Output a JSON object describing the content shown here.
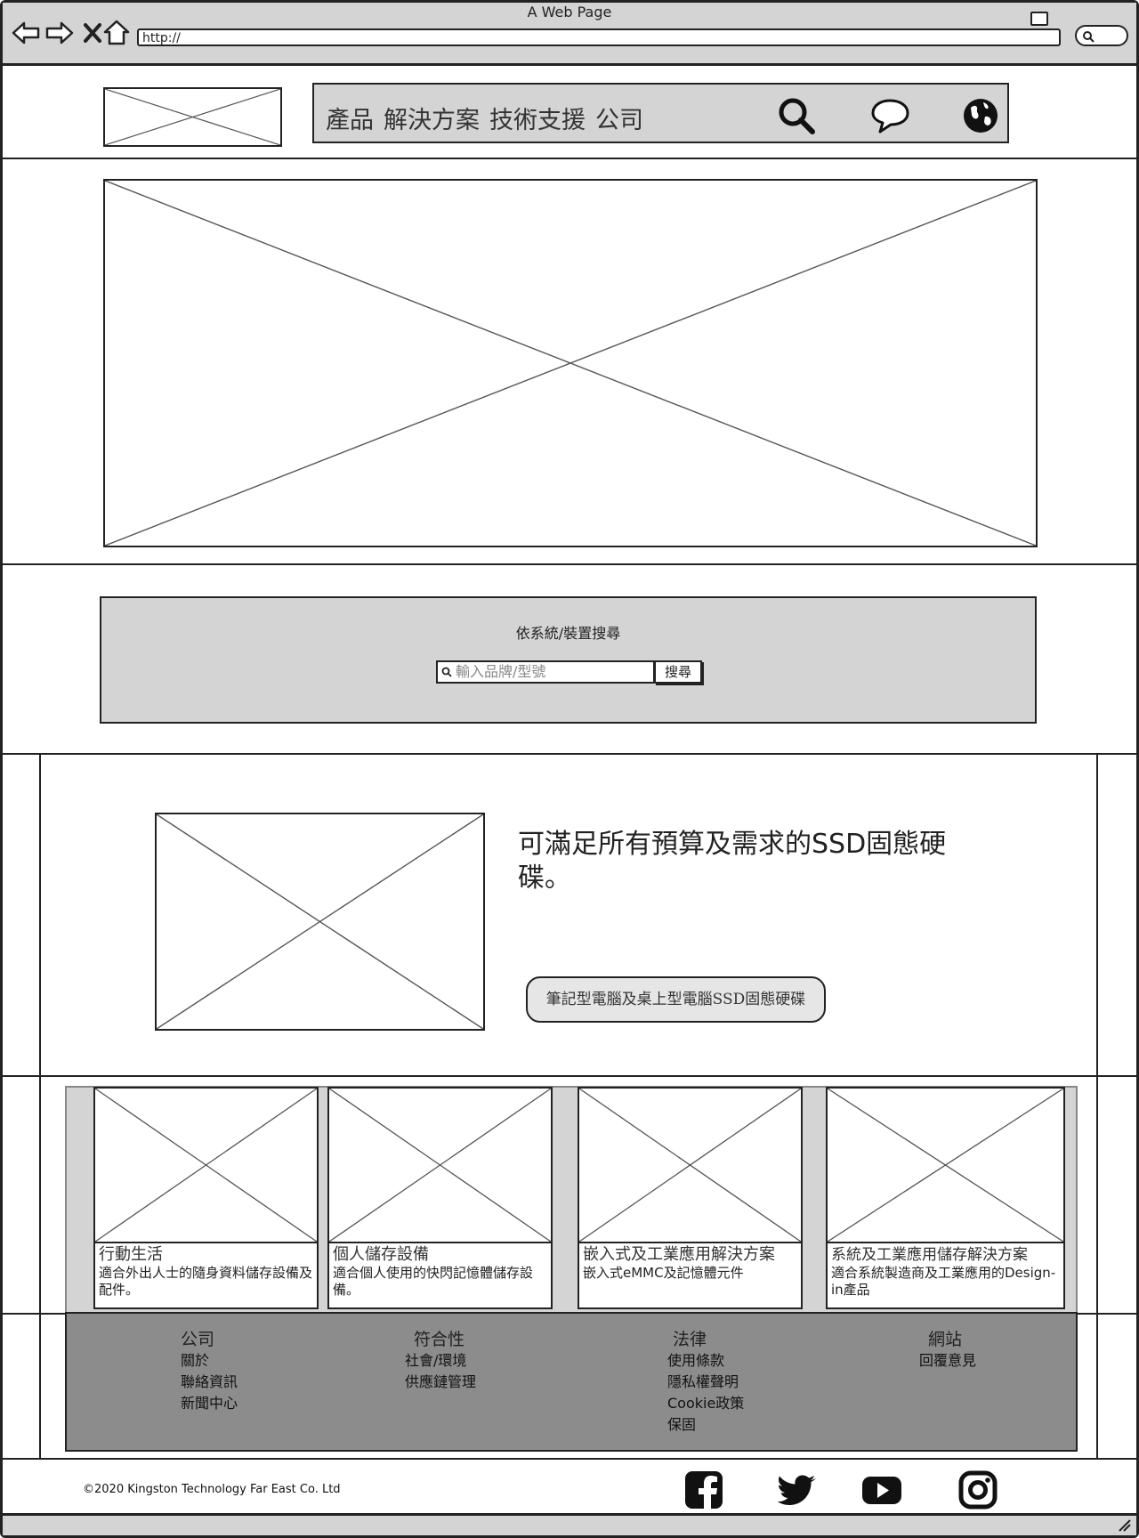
{
  "window": {
    "title": "A Web Page",
    "url": "http://"
  },
  "nav": {
    "items": [
      "產品",
      "解決方案",
      "技術支援",
      "公司"
    ]
  },
  "device_search": {
    "label": "依系統/裝置搜尋",
    "placeholder": "輸入品牌/型號",
    "button": "搜尋"
  },
  "promo": {
    "headline": "可滿足所有預算及需求的SSD固態硬碟。",
    "button": "筆記型電腦及桌上型電腦SSD固態硬碟"
  },
  "cards": [
    {
      "title": "行動生活",
      "desc": "適合外出人士的隨身資料儲存設備及配件。"
    },
    {
      "title": "個人儲存設備",
      "desc": "適合個人使用的快閃記憶體儲存設備。"
    },
    {
      "title": "嵌入式及工業應用解決方案",
      "desc": "嵌入式eMMC及記憶體元件"
    },
    {
      "title": "系統及工業應用儲存解決方案",
      "desc": "適合系統製造商及工業應用的Design-in產品"
    }
  ],
  "footer": {
    "columns": [
      {
        "heading": "公司",
        "links": [
          "關於",
          "聯絡資訊",
          "新聞中心"
        ]
      },
      {
        "heading": "符合性",
        "links": [
          "社會/環境",
          "供應鏈管理"
        ]
      },
      {
        "heading": "法律",
        "links": [
          "使用條款",
          "隱私權聲明",
          "Cookie政策",
          "保固"
        ]
      },
      {
        "heading": "網站",
        "links": [
          "回覆意見"
        ]
      }
    ],
    "copyright": "©2020 Kingston Technology Far East Co. Ltd"
  },
  "icons": [
    "back-icon",
    "forward-icon",
    "stop-icon",
    "home-icon",
    "search-icon",
    "chat-icon",
    "globe-icon",
    "facebook-icon",
    "twitter-icon",
    "youtube-icon",
    "instagram-icon"
  ]
}
